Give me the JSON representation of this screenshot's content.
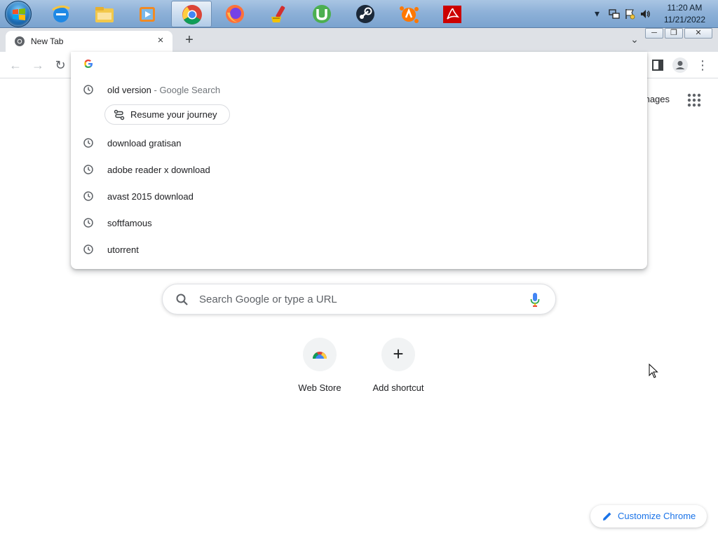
{
  "taskbar": {
    "apps": [
      {
        "name": "internet-explorer-icon",
        "color": "#1e88e5"
      },
      {
        "name": "file-explorer-icon",
        "color": "#f2c84b"
      },
      {
        "name": "media-player-icon",
        "color": "#f08a24"
      },
      {
        "name": "chrome-icon",
        "color": "#4285f4"
      },
      {
        "name": "firefox-icon",
        "color": "#ff7139"
      },
      {
        "name": "ccleaner-icon",
        "color": "#d32f2f"
      },
      {
        "name": "utorrent-icon",
        "color": "#4caf50"
      },
      {
        "name": "steam-icon",
        "color": "#1b2838"
      },
      {
        "name": "avast-icon",
        "color": "#ff7800"
      },
      {
        "name": "adobe-reader-icon",
        "color": "#cc0000"
      }
    ],
    "clock": {
      "time": "11:20 AM",
      "date": "11/21/2022"
    },
    "tray_expand": "▾"
  },
  "window_controls": {
    "minimize": "─",
    "restore": "❐",
    "close": "✕"
  },
  "tabstrip": {
    "tab_title": "New Tab",
    "tab_close": "×",
    "new_tab": "+",
    "tab_search": "⌄"
  },
  "toolbar": {
    "back": "←",
    "forward": "→",
    "reload": "↻",
    "menu": "⋮"
  },
  "omnibox": {
    "suggestions": [
      {
        "text": "old version",
        "separator": " - ",
        "source": "Google Search"
      },
      {
        "text": "download gratisan"
      },
      {
        "text": "adobe reader x download"
      },
      {
        "text": "avast 2015 download"
      },
      {
        "text": "softfamous"
      },
      {
        "text": "utorrent"
      }
    ],
    "journey_label": "Resume your journey"
  },
  "page": {
    "images_link": "mages",
    "search_placeholder": "Search Google or type a URL",
    "shortcuts": [
      {
        "label": "Web Store",
        "symbol": ""
      },
      {
        "label": "Add shortcut",
        "symbol": "+"
      }
    ],
    "customize_label": "Customize Chrome"
  },
  "colors": {
    "accent": "#1a73e8",
    "tabstrip_bg": "#dee1e6",
    "text": "#202124",
    "secondary_text": "#70757a"
  }
}
